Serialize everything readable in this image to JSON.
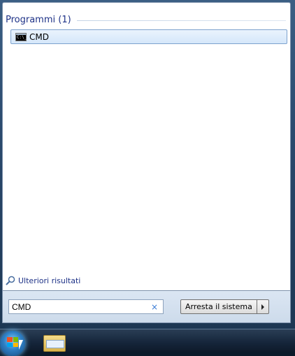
{
  "results": {
    "section_title": "Programmi (1)",
    "items": [
      {
        "label": "CMD",
        "icon": "cmd-icon"
      }
    ],
    "more_results_label": "Ulteriori risultati"
  },
  "search": {
    "value": "CMD",
    "clear_icon": "×"
  },
  "shutdown": {
    "label": "Arresta il sistema"
  },
  "taskbar": {
    "items": [
      "start-orb",
      "windows-explorer"
    ]
  }
}
